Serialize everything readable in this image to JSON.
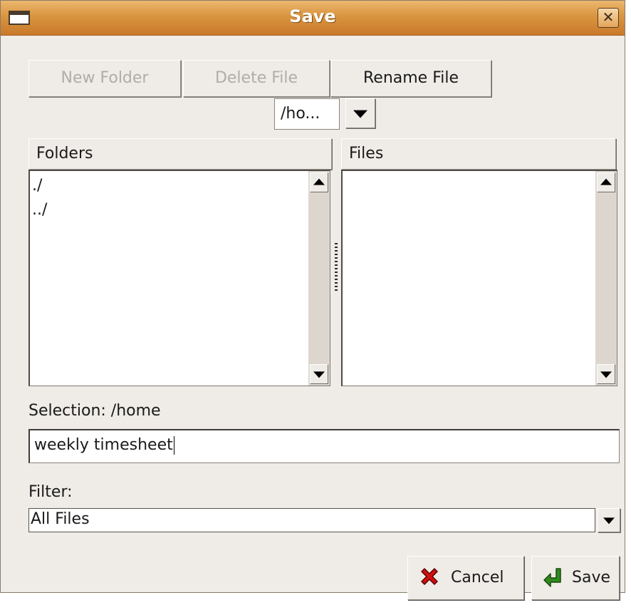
{
  "window": {
    "title": "Save",
    "close_glyph": "✕"
  },
  "toolbar": {
    "new_folder_label": "New Folder",
    "delete_file_label": "Delete File",
    "rename_file_label": "Rename File"
  },
  "path_dropdown": {
    "value": "/ho..."
  },
  "folders": {
    "header": "Folders",
    "items": [
      "./",
      "../"
    ]
  },
  "files": {
    "header": "Files",
    "items": []
  },
  "selection": {
    "label": "Selection: /home",
    "value": "weekly timesheet"
  },
  "filter": {
    "label": "Filter:",
    "value": "All Files"
  },
  "buttons": {
    "cancel_label": "Cancel",
    "save_label": "Save"
  },
  "colors": {
    "titlebar": "#d9953f",
    "window_bg": "#efebe7",
    "cancel_icon": "#d01010",
    "save_icon": "#2f8a1e"
  },
  "icons": {
    "window": "window-icon",
    "close": "close-icon",
    "cancel": "red-x-icon",
    "save": "green-arrow-icon"
  }
}
